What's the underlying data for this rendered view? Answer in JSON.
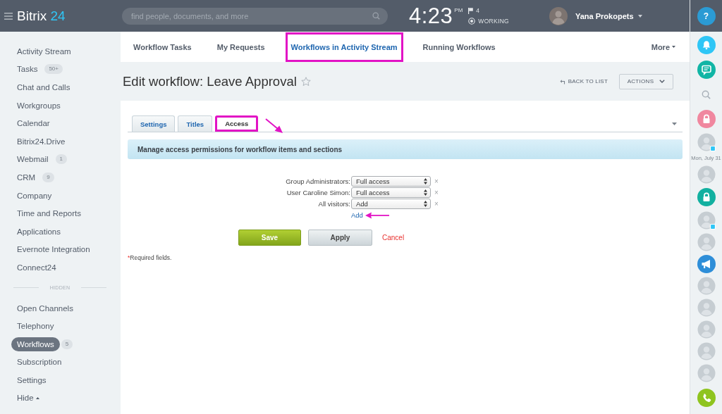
{
  "header": {
    "logo": {
      "name": "Bitrix",
      "suffix": "24"
    },
    "search": {
      "placeholder": "find people, documents, and more"
    },
    "clock": {
      "time": "4:23",
      "period": "PM"
    },
    "flags": "4",
    "work_status": "WORKING",
    "user": {
      "name": "Yana Prokopets"
    }
  },
  "sidebar": {
    "items": [
      {
        "label": "Activity Stream",
        "selected": false
      },
      {
        "label": "Tasks",
        "counter": "50+",
        "selected": false
      },
      {
        "label": "Chat and Calls",
        "selected": false
      },
      {
        "label": "Workgroups",
        "selected": false
      },
      {
        "label": "Calendar",
        "selected": false
      },
      {
        "label": "Bitrix24.Drive",
        "selected": false
      },
      {
        "label": "Webmail",
        "counter": "1",
        "selected": false
      },
      {
        "label": "CRM",
        "counter": "9",
        "selected": false
      },
      {
        "label": "Company",
        "selected": false
      },
      {
        "label": "Time and Reports",
        "selected": false
      },
      {
        "label": "Applications",
        "selected": false
      },
      {
        "label": "Evernote Integration",
        "selected": false
      },
      {
        "label": "Connect24",
        "selected": false
      }
    ],
    "hidden_label": "HIDDEN",
    "hidden_items": [
      {
        "label": "Open Channels",
        "selected": false
      },
      {
        "label": "Telephony",
        "selected": false
      },
      {
        "label": "Workflows",
        "counter": "5",
        "selected": true
      },
      {
        "label": "Subscription",
        "selected": false
      },
      {
        "label": "Settings",
        "selected": false
      }
    ],
    "toggle": "Hide"
  },
  "top_tabs": [
    {
      "label": "Workflow Tasks",
      "selected": false,
      "highlighted": false
    },
    {
      "label": "My Requests",
      "selected": false,
      "highlighted": false
    },
    {
      "label": "Workflows in Activity Stream",
      "selected": true,
      "highlighted": true
    },
    {
      "label": "Running Workflows",
      "selected": false,
      "highlighted": false
    }
  ],
  "more": "More",
  "page": {
    "title": "Edit workflow: Leave Approval",
    "starred": false,
    "back_link": "BACK TO LIST",
    "actions": "ACTIONS"
  },
  "form": {
    "tabs": [
      {
        "label": "Settings",
        "selected": false,
        "highlighted": false
      },
      {
        "label": "Titles",
        "selected": false,
        "highlighted": false
      },
      {
        "label": "Access",
        "selected": true,
        "highlighted": true
      }
    ],
    "info": "Manage access permissions for workflow items and sections",
    "permissions": [
      {
        "label": "Group Administrators:",
        "value": "Full access",
        "remove": "×"
      },
      {
        "label": "User Caroline Simon:",
        "value": "Full access",
        "remove": "×"
      },
      {
        "label": "All visitors:",
        "value": "Add",
        "remove": "×"
      }
    ],
    "add_link": {
      "label": "Add",
      "highlighted": true
    },
    "buttons": [
      {
        "kind": "primary",
        "label": "Save"
      },
      {
        "kind": "secondary",
        "label": "Apply"
      },
      {
        "kind": "link",
        "label": "Cancel"
      }
    ],
    "required": {
      "mark": "*",
      "text": "Required fields."
    }
  },
  "right_panel": {
    "help": "?",
    "items": [
      {
        "kind": "bell"
      },
      {
        "kind": "chat"
      },
      {
        "kind": "search"
      },
      {
        "kind": "lock",
        "color": "#f0879f"
      },
      {
        "kind": "avatar",
        "badge": true
      },
      {
        "kind": "date",
        "label": "Mon, July 31"
      },
      {
        "kind": "avatar",
        "badge": false
      },
      {
        "kind": "lock",
        "color": "#12b0a0"
      },
      {
        "kind": "avatar",
        "badge": true
      },
      {
        "kind": "avatar",
        "badge": false
      },
      {
        "kind": "megaphone"
      },
      {
        "kind": "avatar",
        "badge": false
      },
      {
        "kind": "avatar",
        "badge": false
      },
      {
        "kind": "avatar",
        "badge": false
      },
      {
        "kind": "avatar",
        "badge": false
      },
      {
        "kind": "avatar",
        "badge": false
      },
      {
        "kind": "phone"
      }
    ]
  }
}
